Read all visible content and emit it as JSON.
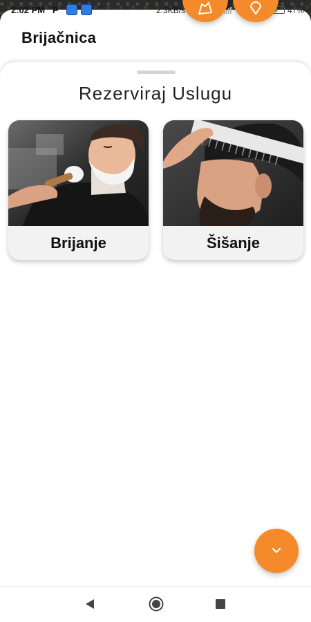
{
  "status_bar": {
    "time": "2:02 PM",
    "p_icon_text": "P",
    "net_speed": "2.3KB/s",
    "battery_percent": "47%",
    "battery_level": 0.47
  },
  "app": {
    "title": "Brijačnica"
  },
  "sheet": {
    "title": "Rezerviraj Uslugu",
    "services": [
      {
        "label": "Brijanje",
        "image": "shaving-photo"
      },
      {
        "label": "Šišanje",
        "image": "haircut-photo"
      }
    ]
  },
  "icons": {
    "top_fab_left": "map-icon",
    "top_fab_right": "location-pin-icon",
    "bottom_fab": "chevron-down-icon",
    "nav_back": "back-triangle-icon",
    "nav_home": "home-circle-icon",
    "nav_recent": "recent-apps-square-icon"
  },
  "colors": {
    "accent": "#f58a2a",
    "text": "#111111",
    "sheet_bg": "#ffffff"
  }
}
